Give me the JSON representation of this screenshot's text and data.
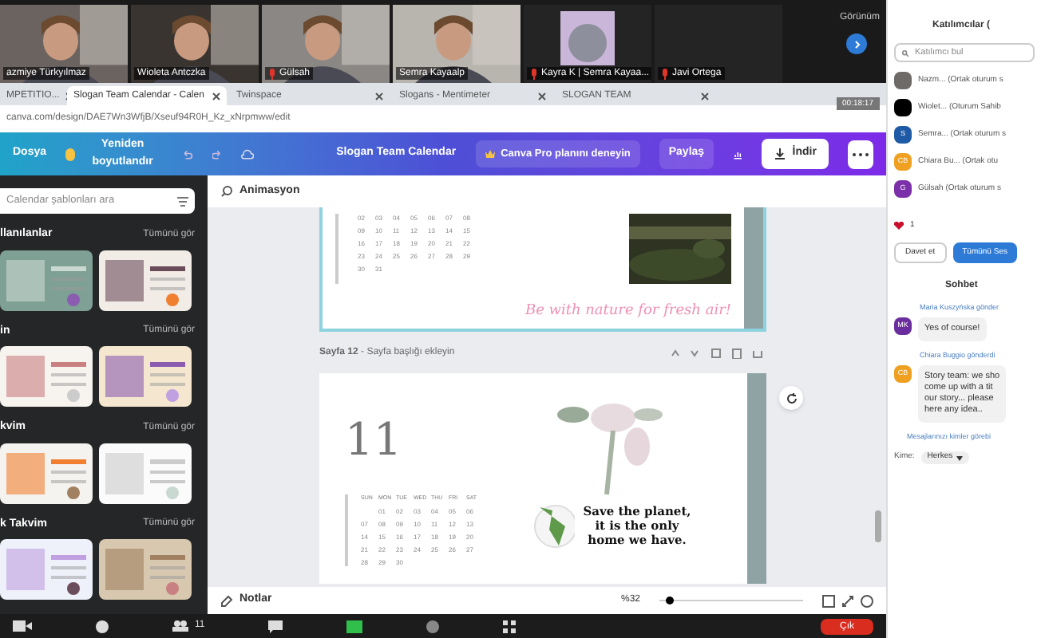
{
  "video_strip": {
    "tiles": [
      {
        "name": "azmiye Türkyılmaz",
        "kind": "video",
        "muted": false
      },
      {
        "name": "Wioleta Antczka",
        "kind": "video",
        "muted": false
      },
      {
        "name": "Gülsah",
        "kind": "video",
        "muted": true
      },
      {
        "name": "Semra Kayaalp",
        "kind": "video",
        "muted": false
      },
      {
        "name": "Kayra K | Semra Kayaa...",
        "kind": "avatar",
        "muted": true
      },
      {
        "name": "Javi Ortega",
        "kind": "speaker",
        "muted": true
      }
    ],
    "view_label": "Görünüm"
  },
  "browser": {
    "tabs": [
      {
        "label": "MPETITIO...",
        "selected": false
      },
      {
        "label": "Slogan Team Calendar - Calen",
        "selected": true
      },
      {
        "label": "Twinspace",
        "selected": false
      },
      {
        "label": "Slogans - Mentimeter",
        "selected": false
      },
      {
        "label": "SLOGAN TEAM",
        "selected": false
      }
    ],
    "timer": "00:18:17",
    "url": "canva.com/design/DAE7Wn3WfjB/Xseuf94R0H_Kz_xNrpmww/edit"
  },
  "editor_toolbar": {
    "file": "Dosya",
    "resize": "Yeniden boyutlandır",
    "title": "Slogan Team Calendar",
    "pro": "Canva Pro planını deneyin",
    "share": "Paylaş",
    "download": "İndir"
  },
  "templates_panel": {
    "search": {
      "placeholder": "Calendar şablonları ara"
    },
    "sections": [
      {
        "title": "llanılanlar",
        "see_all": "Tümünü gör"
      },
      {
        "title": "in",
        "see_all": "Tümünü gör"
      },
      {
        "title": "kvim",
        "see_all": "Tümünü gör"
      },
      {
        "title": "k Takvim",
        "see_all": "Tümünü gör"
      }
    ]
  },
  "canvas": {
    "animation": "Animasyon",
    "page_top": {
      "rows": [
        [
          "02",
          "03",
          "04",
          "05",
          "06",
          "07",
          "08"
        ],
        [
          "09",
          "10",
          "11",
          "12",
          "13",
          "14",
          "15"
        ],
        [
          "16",
          "17",
          "18",
          "19",
          "20",
          "21",
          "22"
        ],
        [
          "23",
          "24",
          "25",
          "26",
          "27",
          "28",
          "29"
        ],
        [
          "30",
          "31"
        ]
      ],
      "slogan": "Be with nature for fresh air!"
    },
    "page_header": {
      "title": "**Sayfa 12** - Sayfa başlığı ekleyin"
    },
    "page": {
      "month": "11",
      "weekdays": [
        "SUN",
        "MON",
        "TUE",
        "WED",
        "THU",
        "FRI",
        "SAT"
      ],
      "rows": [
        [
          "",
          "01",
          "02",
          "03",
          "04",
          "05",
          "06"
        ],
        [
          "07",
          "08",
          "09",
          "10",
          "11",
          "12",
          "13"
        ],
        [
          "14",
          "15",
          "16",
          "17",
          "18",
          "19",
          "20"
        ],
        [
          "21",
          "22",
          "23",
          "24",
          "25",
          "26",
          "27"
        ],
        [
          "28",
          "29",
          "30"
        ]
      ],
      "slogan": "Save the planet, it is the only home we have."
    },
    "notes": "Notlar",
    "zoom": "%32"
  },
  "meeting_bar": {
    "participants": "11",
    "leave": "Çık"
  },
  "side_panel": {
    "participants_title": "Katılımcılar (",
    "search": {
      "placeholder": "Katılımcı bul"
    },
    "participants": [
      {
        "name": "Nazm... (Ortak oturum s",
        "color": "#6d6a68"
      },
      {
        "name": "Wiolet... (Oturum Sahib",
        "color": "#000000"
      },
      {
        "name": "Semra... (Ortak oturum s",
        "kind": "initials",
        "initials": "S",
        "color": "#1f5aa6"
      },
      {
        "name": "Chiara Bu... (Ortak otu",
        "kind": "initials",
        "initials": "CB",
        "color": "#f0a020"
      },
      {
        "name": "Gülsah (Ortak oturum s",
        "kind": "initials",
        "initials": "G",
        "color": "#7b2fa8"
      }
    ],
    "reactions": "1",
    "invite": "Davet et",
    "mute_all": "Tümünü Ses",
    "chat_title": "Sohbet",
    "messages": [
      {
        "sender": "Maria Kuszyńska gönder",
        "initials": "MK",
        "color": "#6a2d9e",
        "lines": [
          "Yes of course!"
        ]
      },
      {
        "sender": "Chiara Buggio gönderdi",
        "initials": "CB",
        "color": "#f0a020",
        "lines": [
          "Story team: we sho",
          "come up with a tit",
          "our story... please",
          "here any idea.."
        ]
      }
    ],
    "visibility": "Mesajlarınızı kimler görebi",
    "to_label": "Kime:",
    "to_value": "Herkes"
  }
}
